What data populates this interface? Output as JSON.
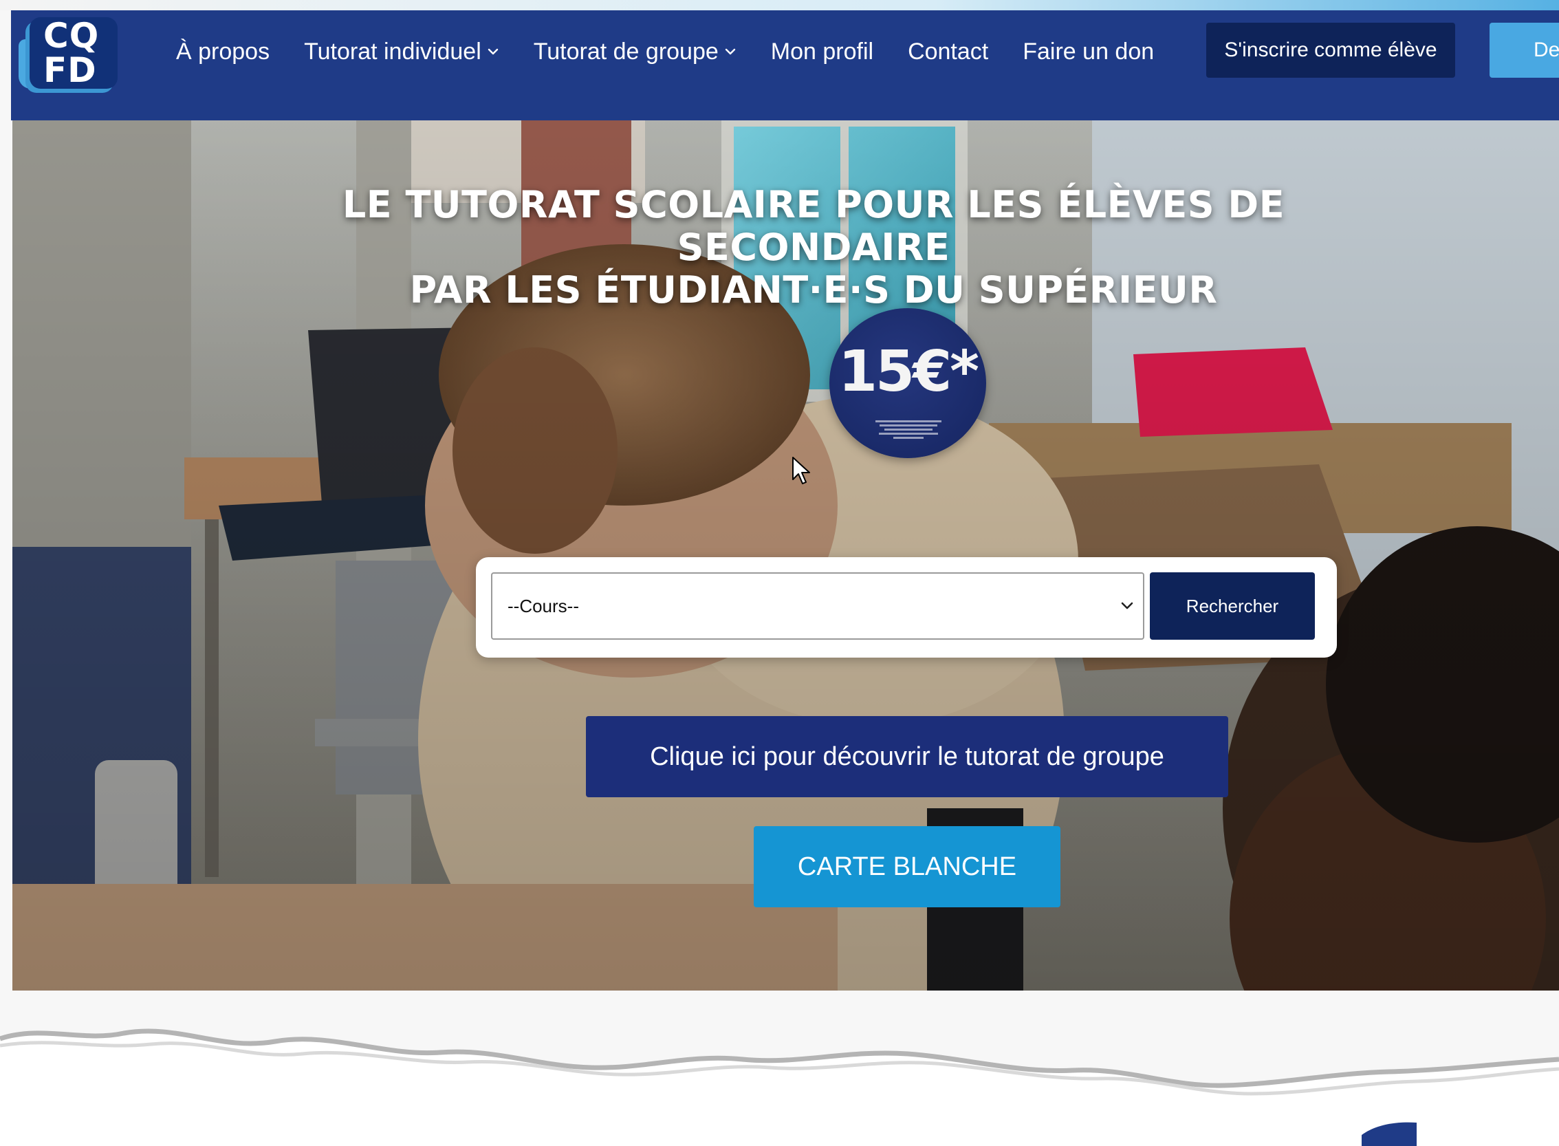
{
  "logo": {
    "line1": "CQ",
    "line2": "FD"
  },
  "nav": {
    "items": [
      {
        "label": "À propos",
        "has_dropdown": false
      },
      {
        "label": "Tutorat individuel",
        "has_dropdown": true
      },
      {
        "label": "Tutorat de groupe",
        "has_dropdown": true
      },
      {
        "label": "Mon profil",
        "has_dropdown": false
      },
      {
        "label": "Contact",
        "has_dropdown": false
      },
      {
        "label": "Faire un don",
        "has_dropdown": false
      }
    ],
    "signup_label": "S'inscrire comme élève",
    "tutor_label": "Dev"
  },
  "hero": {
    "title_line1": "LE TUTORAT SCOLAIRE POUR LES ÉLÈVES DE SECONDAIRE",
    "title_line2": "PAR LES ÉTUDIANT·E·S DU SUPÉRIEUR",
    "badge_price": "15€*"
  },
  "search": {
    "select_value": "--Cours--",
    "button_label": "Rechercher"
  },
  "cta": {
    "group_label": "Clique ici pour découvrir le tutorat de groupe",
    "carte_label": "CARTE BLANCHE"
  },
  "colors": {
    "navbar": "#1f3b87",
    "dark_navy": "#0e2359",
    "group_button": "#1c2e7a",
    "accent_blue": "#1595d3",
    "tutor_button": "#49a8e2"
  }
}
